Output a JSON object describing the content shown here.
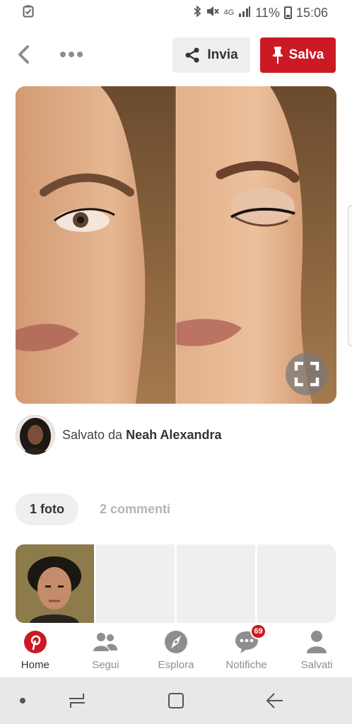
{
  "status_bar": {
    "network": "4G",
    "battery_percent": "11%",
    "time": "15:06",
    "icons": [
      "gallery-icon",
      "bluetooth-icon",
      "mute-icon",
      "signal-icon",
      "battery-icon"
    ]
  },
  "top_bar": {
    "invia_label": "Invia",
    "salva_label": "Salva",
    "icons": [
      "back-arrow-icon",
      "more-dots-icon",
      "share-icon",
      "pin-icon"
    ]
  },
  "pin": {
    "expand_icon": "expand-icon"
  },
  "saved_by": {
    "prefix": "Salvato da",
    "name": "Neah Alexandra"
  },
  "tabs": {
    "photos": "1 foto",
    "comments": "2 commenti"
  },
  "bottom_nav": {
    "items": [
      {
        "label": "Home",
        "icon": "pinterest-logo-icon",
        "active": true
      },
      {
        "label": "Segui",
        "icon": "people-icon"
      },
      {
        "label": "Esplora",
        "icon": "compass-icon"
      },
      {
        "label": "Notifiche",
        "icon": "chat-bubble-icon",
        "badge": "69"
      },
      {
        "label": "Salvati",
        "icon": "person-icon"
      }
    ]
  },
  "system_nav": {
    "icons": [
      "dot-icon",
      "recent-apps-icon",
      "home-icon",
      "back-icon"
    ]
  },
  "colors": {
    "brand_red": "#cb1a23",
    "button_grey": "#efefef",
    "inactive_text": "#8e8e8e"
  }
}
